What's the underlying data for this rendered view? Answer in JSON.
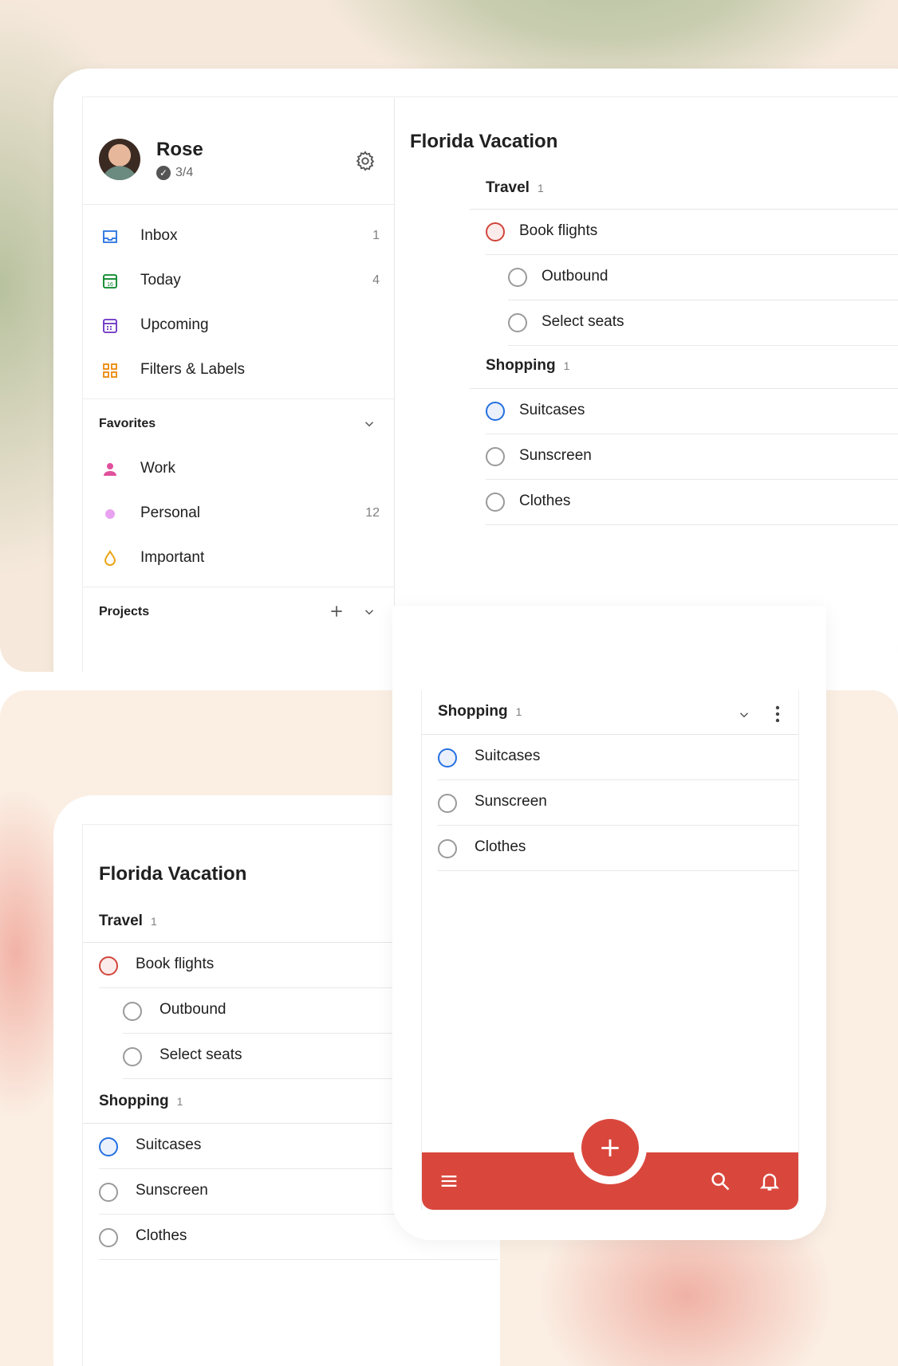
{
  "profile": {
    "name": "Rose",
    "karma": "3/4"
  },
  "nav": [
    {
      "label": "Inbox",
      "count": "1"
    },
    {
      "label": "Today",
      "count": "4"
    },
    {
      "label": "Upcoming",
      "count": ""
    },
    {
      "label": "Filters & Labels",
      "count": ""
    }
  ],
  "favorites": {
    "title": "Favorites",
    "items": [
      {
        "label": "Work",
        "count": ""
      },
      {
        "label": "Personal",
        "count": "12"
      },
      {
        "label": "Important",
        "count": ""
      }
    ]
  },
  "projects_title": "Projects",
  "project": {
    "title": "Florida Vacation",
    "sections": [
      {
        "name": "Travel",
        "count": "1",
        "tasks": [
          {
            "label": "Book flights",
            "priority": "p1"
          },
          {
            "label": "Outbound",
            "sub": true
          },
          {
            "label": "Select seats",
            "sub": true
          }
        ]
      },
      {
        "name": "Shopping",
        "count": "1",
        "tasks": [
          {
            "label": "Suitcases",
            "priority": "p3"
          },
          {
            "label": "Sunscreen"
          },
          {
            "label": "Clothes"
          }
        ]
      }
    ]
  },
  "colors": {
    "brand_red": "#d9473c",
    "priority1": "#d1453b",
    "priority3": "#246fe0"
  },
  "icons": [
    "inbox-icon",
    "today-icon",
    "upcoming-icon",
    "filters-labels-icon",
    "settings-icon",
    "work-icon",
    "personal-dot-icon",
    "important-drop-icon",
    "add-icon",
    "chevron-down-icon",
    "more-icon",
    "menu-icon",
    "search-icon",
    "bell-icon",
    "wifi-icon",
    "signal-icon"
  ]
}
